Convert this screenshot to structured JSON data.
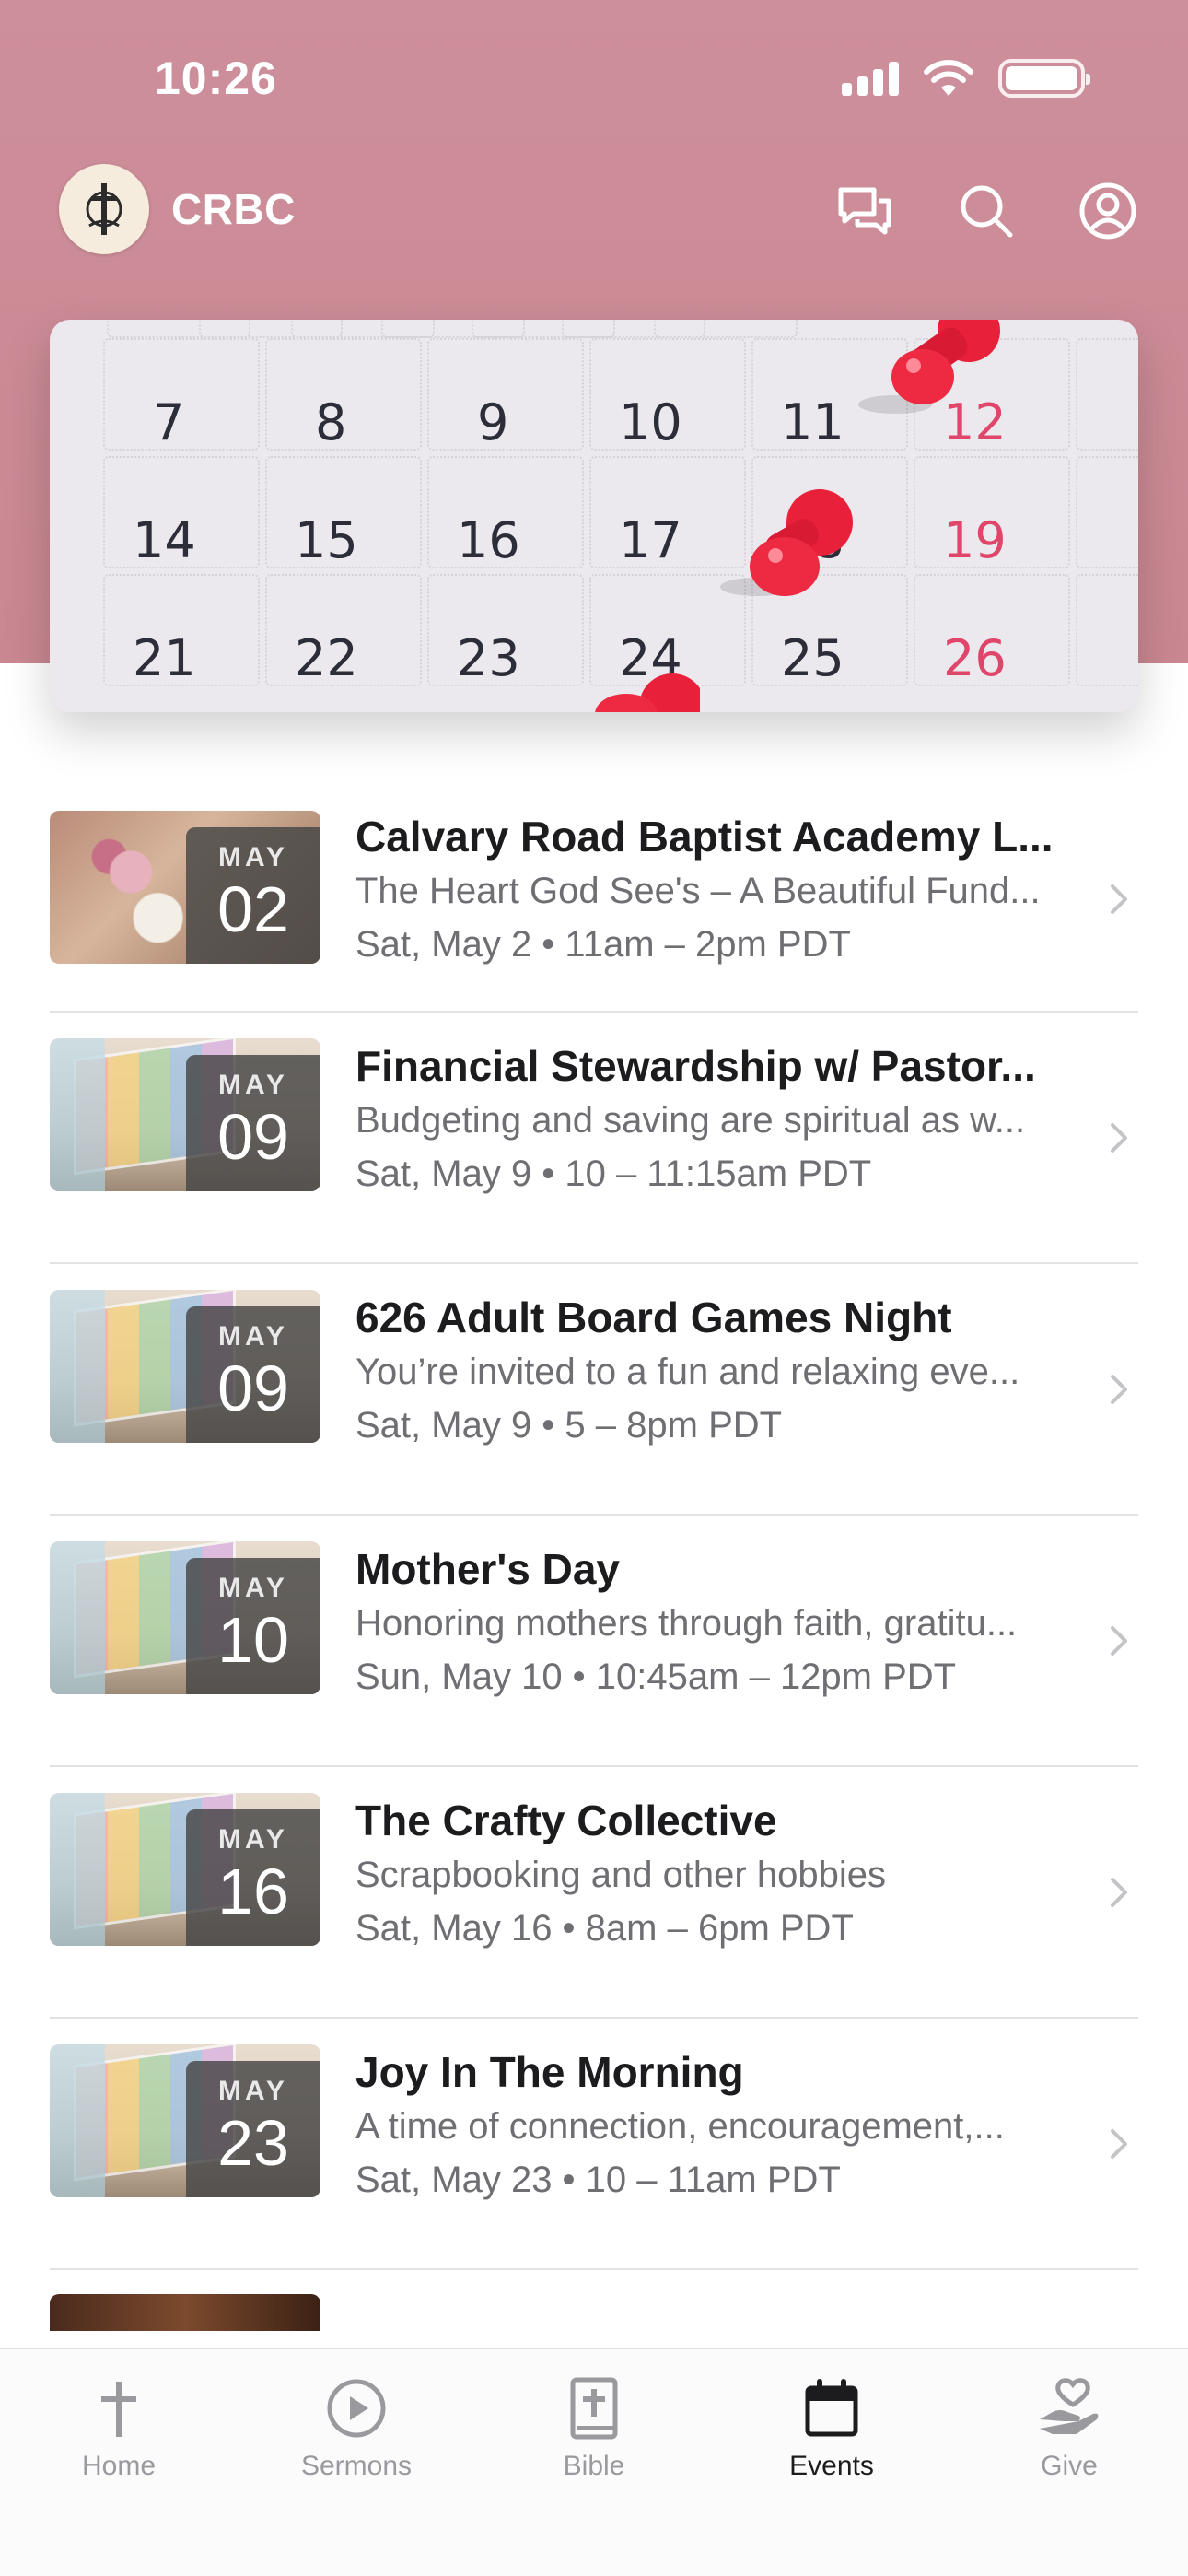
{
  "status_bar": {
    "time": "10:26"
  },
  "app_bar": {
    "brand": "CRBC"
  },
  "hero": {
    "calendar_numbers": [
      [
        "7",
        "8",
        "9",
        "10",
        "11",
        "12"
      ],
      [
        "14",
        "15",
        "16",
        "17",
        "18",
        "19"
      ],
      [
        "21",
        "22",
        "23",
        "24",
        "25",
        "26"
      ]
    ]
  },
  "events": [
    {
      "month": "MAY",
      "day": "02",
      "title": "Calvary Road Baptist Academy L...",
      "description": "The Heart God See's – A Beautiful Fund...",
      "time": "Sat, May 2 • 11am – 2pm PDT"
    },
    {
      "month": "MAY",
      "day": "09",
      "title": "Financial Stewardship w/ Pastor...",
      "description": "Budgeting and saving are spiritual as w...",
      "time": "Sat, May 9 • 10 – 11:15am PDT"
    },
    {
      "month": "MAY",
      "day": "09",
      "title": "626 Adult Board Games Night",
      "description": "You’re invited to a fun and relaxing eve...",
      "time": "Sat, May 9 • 5 – 8pm PDT"
    },
    {
      "month": "MAY",
      "day": "10",
      "title": "Mother's Day",
      "description": "Honoring mothers through faith, gratitu...",
      "time": "Sun, May 10 • 10:45am – 12pm PDT"
    },
    {
      "month": "MAY",
      "day": "16",
      "title": "The Crafty Collective",
      "description": "Scrapbooking and other hobbies",
      "time": "Sat, May 16 • 8am – 6pm PDT"
    },
    {
      "month": "MAY",
      "day": "23",
      "title": "Joy In The Morning",
      "description": "A time of connection, encouragement,...",
      "time": "Sat, May 23 • 10 – 11am PDT"
    }
  ],
  "tab_bar": {
    "tabs": [
      {
        "label": "Home",
        "icon": "cross-icon"
      },
      {
        "label": "Sermons",
        "icon": "play-circle-icon"
      },
      {
        "label": "Bible",
        "icon": "bible-icon"
      },
      {
        "label": "Events",
        "icon": "calendar-icon",
        "active": true
      },
      {
        "label": "Give",
        "icon": "heart-hand-icon"
      }
    ]
  },
  "colors": {
    "header": "#cd8f9b",
    "weekend_red": "#e0456a",
    "pin_red": "#e8203a"
  }
}
